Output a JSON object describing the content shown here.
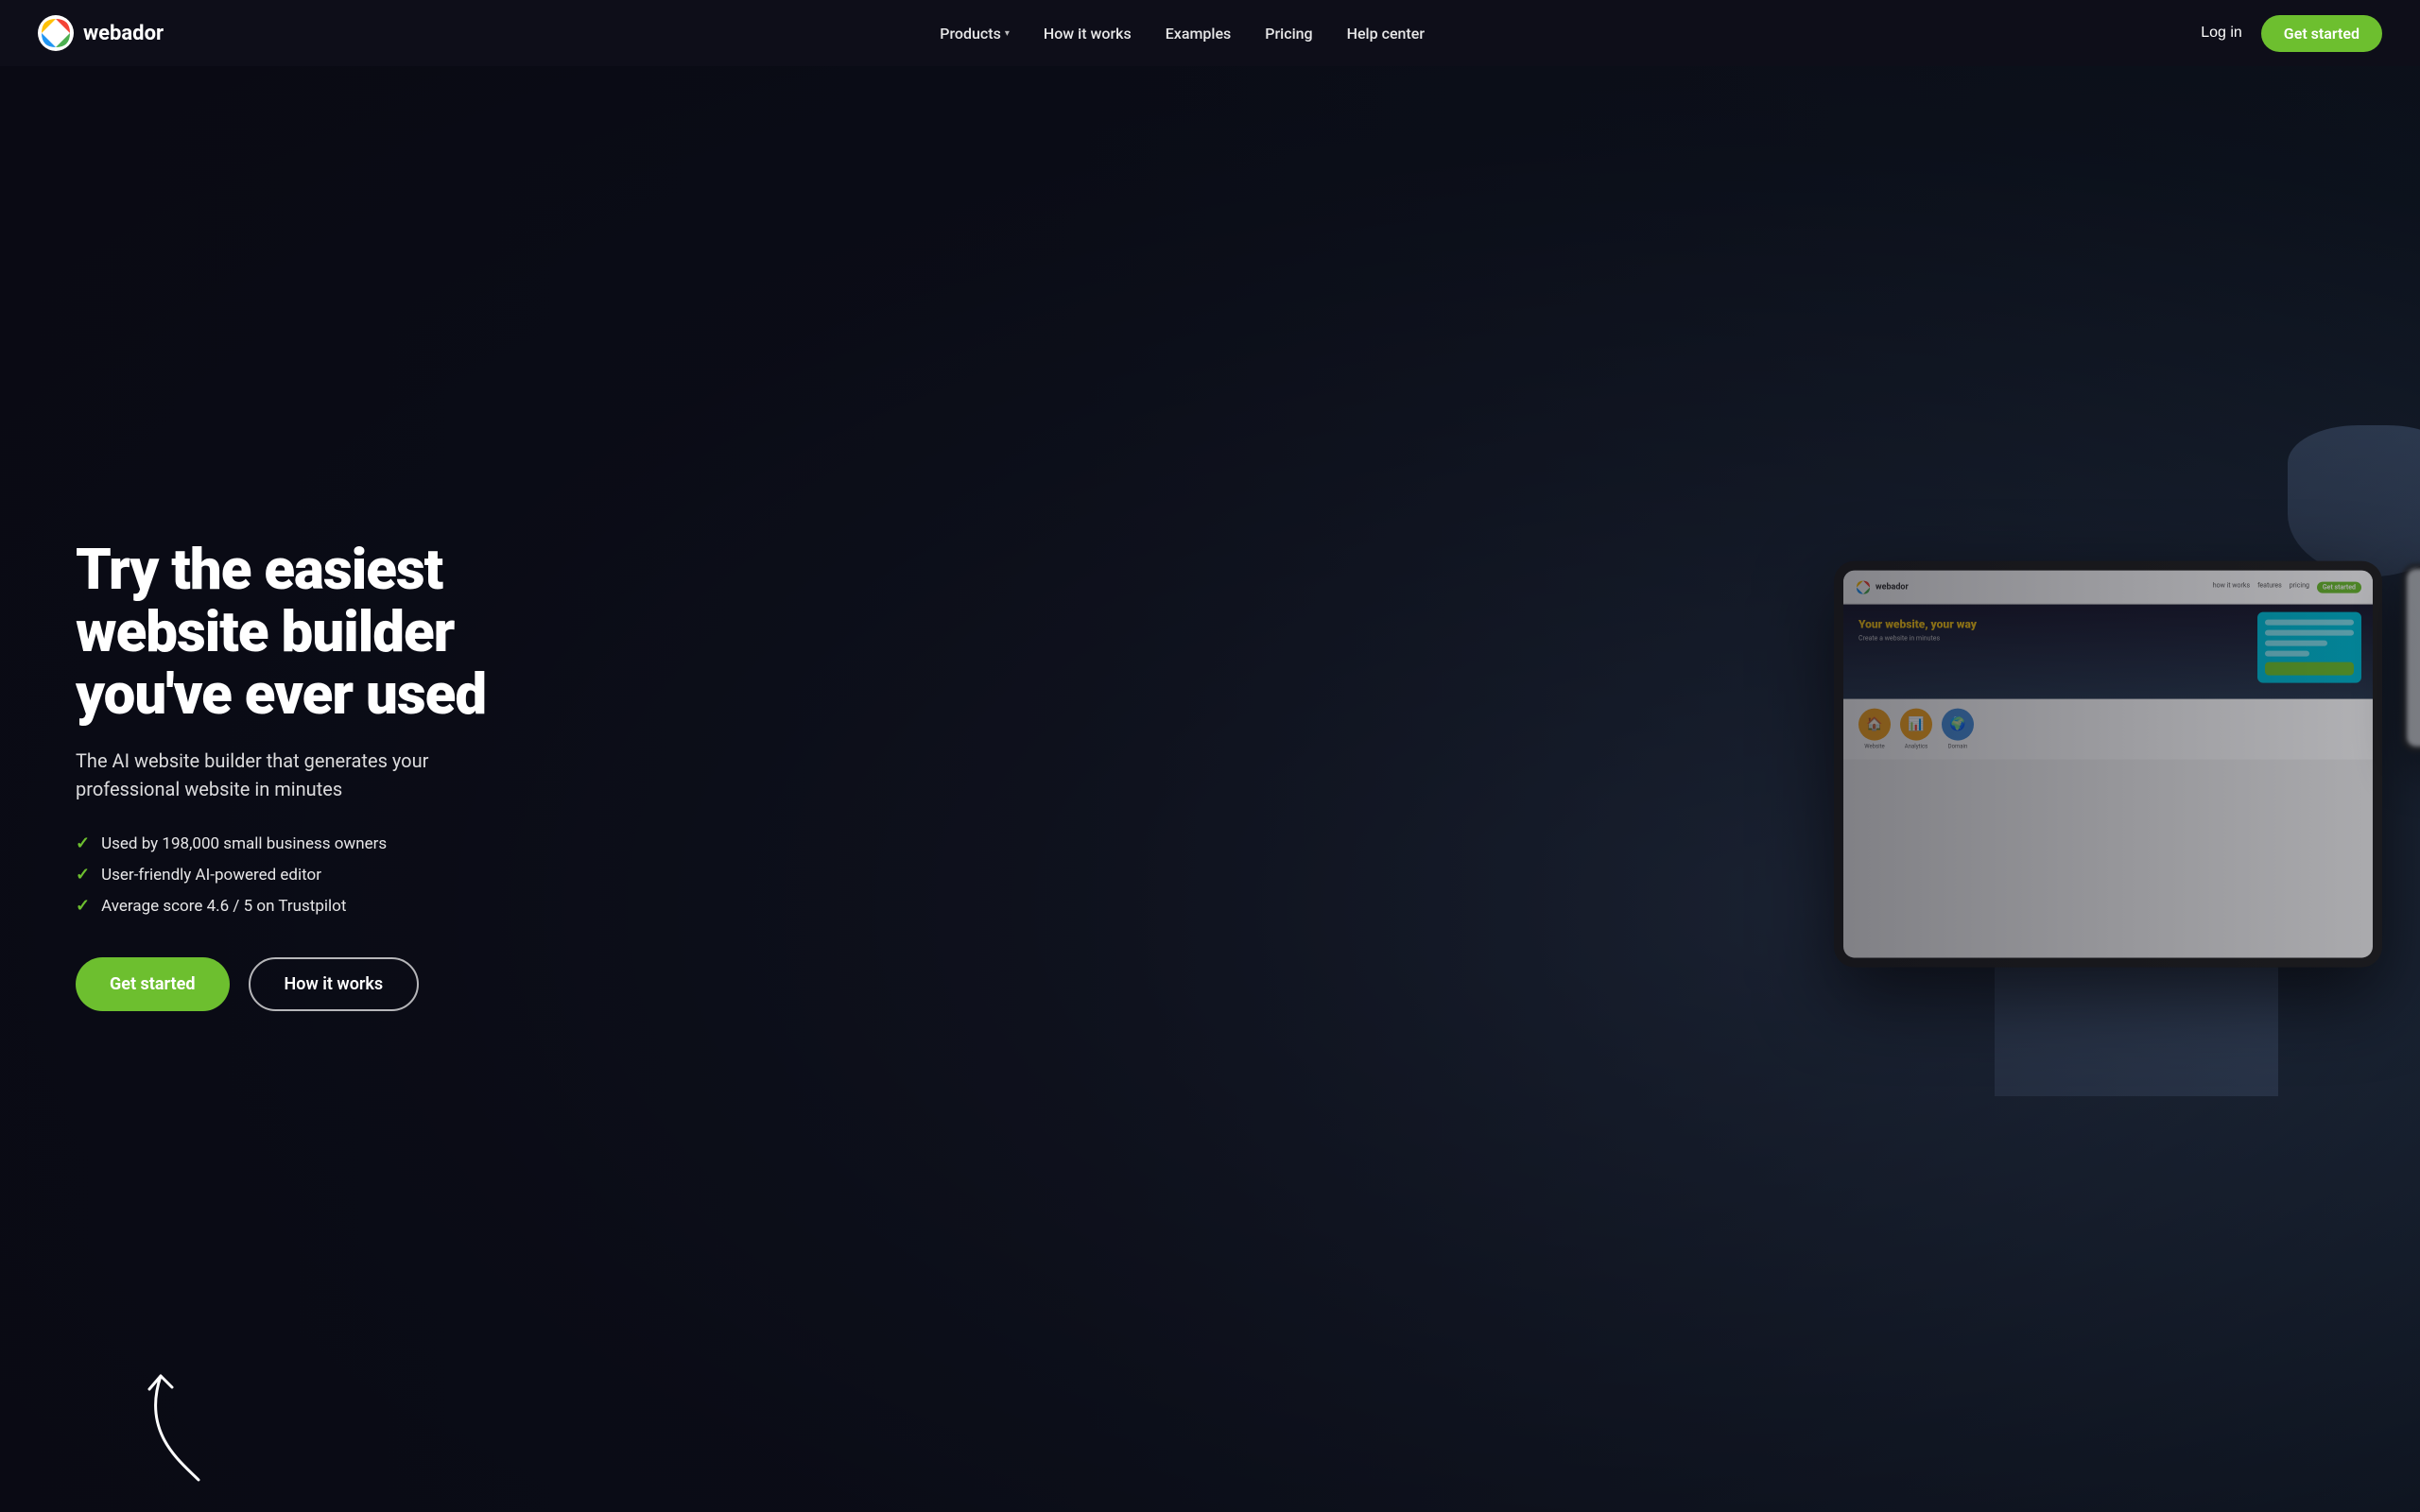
{
  "brand": {
    "name": "webador",
    "logo_alt": "Webador logo"
  },
  "nav": {
    "products_label": "Products",
    "how_it_works_label": "How it works",
    "examples_label": "Examples",
    "pricing_label": "Pricing",
    "help_center_label": "Help center",
    "login_label": "Log in",
    "get_started_label": "Get started"
  },
  "hero": {
    "title": "Try the easiest website builder you've ever used",
    "subtitle": "The AI website builder that generates your professional website in minutes",
    "features": [
      "Used by 198,000 small business owners",
      "User-friendly AI-powered editor",
      "Average score 4.6 / 5 on Trustpilot"
    ],
    "cta_primary": "Get started",
    "cta_secondary": "How it works"
  },
  "mini_tablet": {
    "logo_text": "webador",
    "nav_links": [
      "how it works",
      "features",
      "pricing"
    ],
    "hero_title": "Your website, your way",
    "hero_sub": "Create a website in minutes",
    "features": [
      {
        "color": "#f5a623",
        "icon": "🏠"
      },
      {
        "color": "#f5a623",
        "icon": "📊"
      },
      {
        "color": "#4a90d9",
        "icon": "🌍"
      }
    ]
  },
  "icons": {
    "chevron_down": "▾",
    "checkmark": "✓"
  },
  "colors": {
    "brand_green": "#6dbf2f",
    "accent_cyan": "#00bcd4",
    "dark_bg": "#0d1520",
    "navbar_bg": "rgba(15,15,25,0.95)"
  }
}
